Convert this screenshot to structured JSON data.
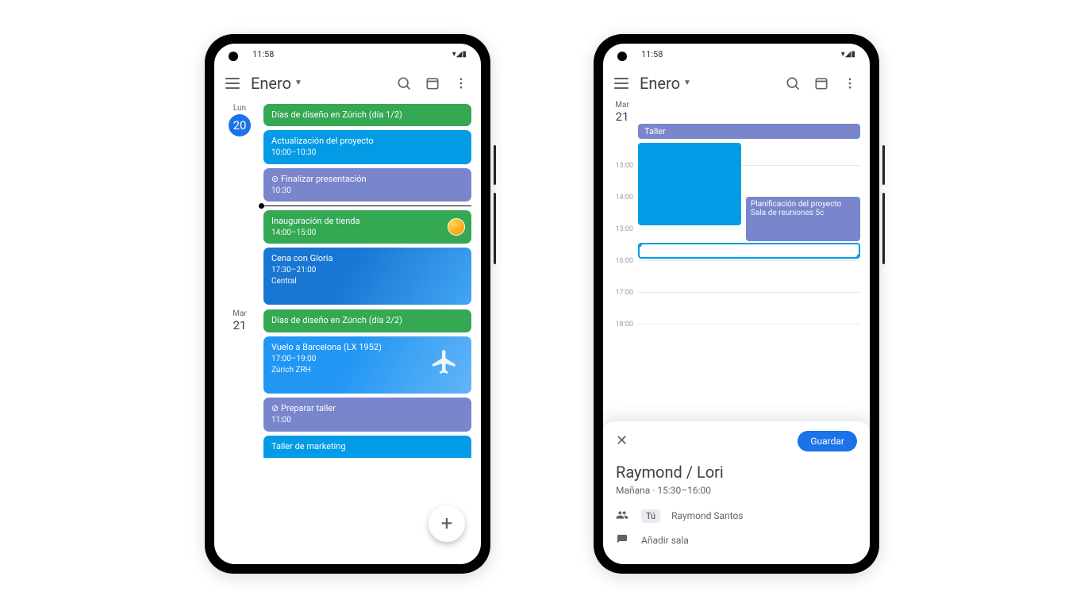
{
  "status": {
    "time": "11:58",
    "icons": "▾◢▮"
  },
  "header": {
    "month": "Enero"
  },
  "phone1": {
    "day1": {
      "dow": "Lun",
      "num": "20",
      "events": [
        {
          "title": "Días de diseño en Zúrich (día 1/2)"
        },
        {
          "title": "Actualización del proyecto",
          "sub": "10:00–10:30"
        },
        {
          "title": "⊘ Finalizar presentación",
          "sub": "10:30"
        },
        {
          "title": "Inauguración de tienda",
          "sub": "14:00–15:00"
        },
        {
          "title": "Cena con Gloria",
          "sub": "17:30–21:00",
          "sub2": "Central"
        }
      ]
    },
    "day2": {
      "dow": "Mar",
      "num": "21",
      "events": [
        {
          "title": "Días de diseño en Zúrich (día 2/2)"
        },
        {
          "title": "Vuelo a Barcelona (LX 1952)",
          "sub": "17:00–19:00",
          "sub2": "Zúrich ZRH"
        },
        {
          "title": "⊘ Preparar taller",
          "sub": "11:00"
        },
        {
          "title": "Taller de marketing"
        }
      ]
    }
  },
  "phone2": {
    "day": {
      "dow": "Mar",
      "num": "21"
    },
    "allday": "Taller",
    "hours": [
      "13:00",
      "14:00",
      "15:00",
      "16:00",
      "17:00",
      "18:00"
    ],
    "blockA": "",
    "blockB": {
      "t": "Planificación del proyecto",
      "s": "Sala de reuniones 5c"
    },
    "sheet": {
      "save": "Guardar",
      "title": "Raymond / Lori",
      "when": "Mañana · 15:30–16:00",
      "you": "Tú",
      "guest": "Raymond Santos",
      "addroom": "Añadir sala"
    }
  }
}
